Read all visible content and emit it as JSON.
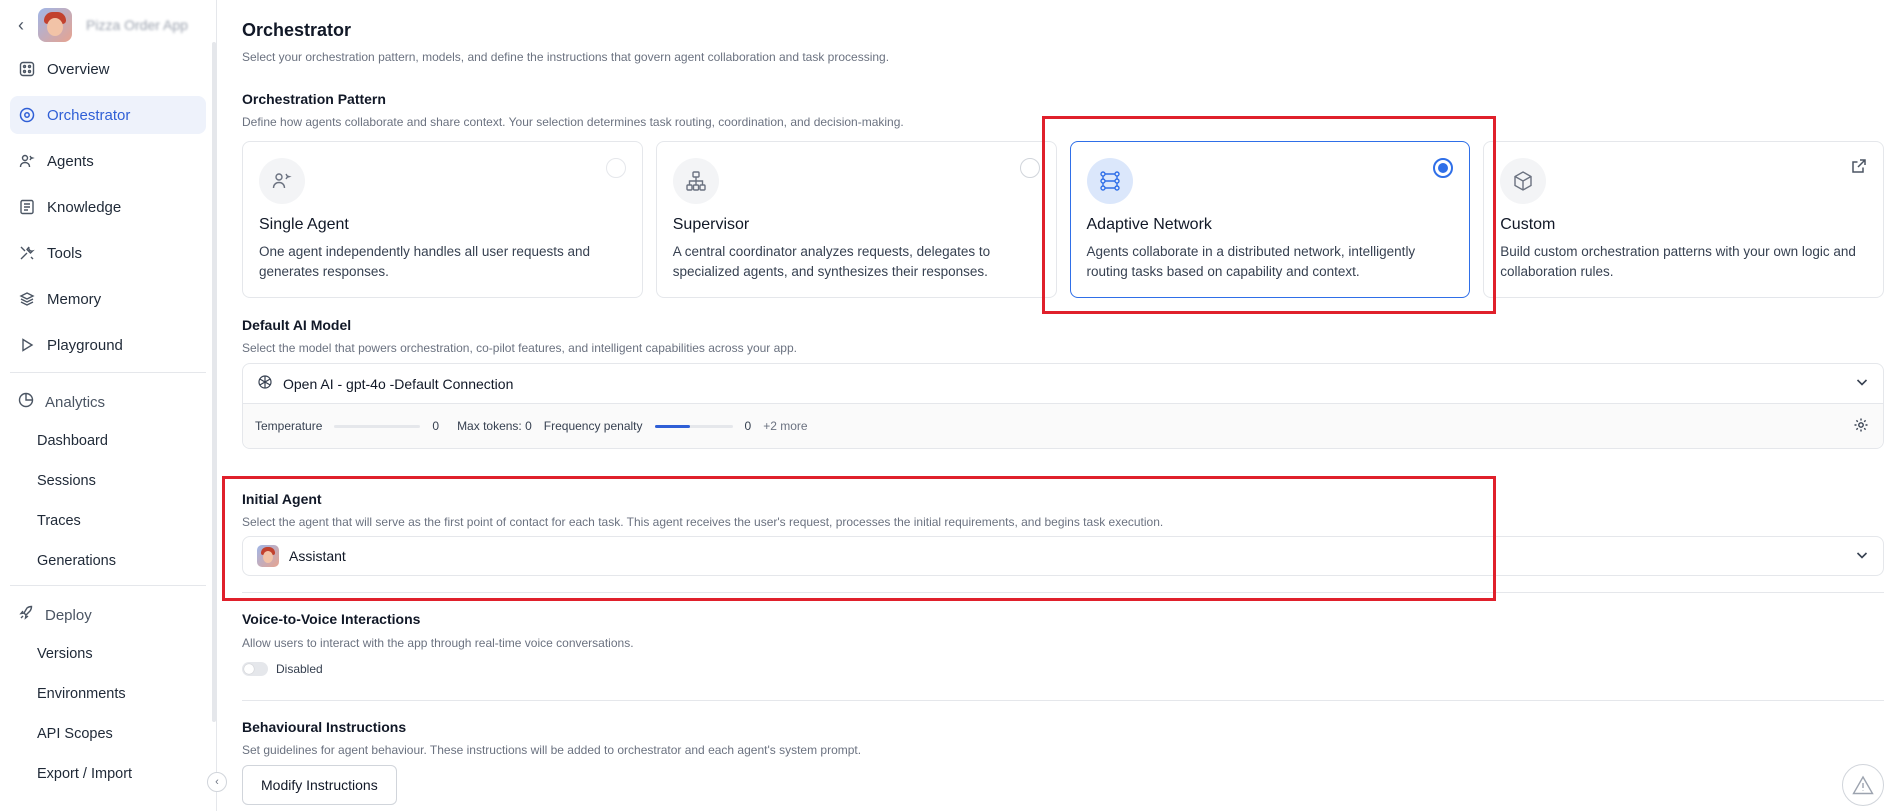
{
  "sidebar": {
    "app_name": "Pizza Order App",
    "items": [
      {
        "label": "Overview",
        "icon": "grid-icon"
      },
      {
        "label": "Orchestrator",
        "icon": "orchestrator-icon"
      },
      {
        "label": "Agents",
        "icon": "agents-icon"
      },
      {
        "label": "Knowledge",
        "icon": "book-icon"
      },
      {
        "label": "Tools",
        "icon": "tools-icon"
      },
      {
        "label": "Memory",
        "icon": "layers-icon"
      },
      {
        "label": "Playground",
        "icon": "play-icon"
      }
    ],
    "analytics": {
      "label": "Analytics",
      "items": [
        "Dashboard",
        "Sessions",
        "Traces",
        "Generations"
      ]
    },
    "deploy": {
      "label": "Deploy",
      "items": [
        "Versions",
        "Environments",
        "API Scopes",
        "Export / Import"
      ]
    }
  },
  "main": {
    "title": "Orchestrator",
    "subtitle": "Select your orchestration pattern, models, and define the instructions that govern agent collaboration and task processing.",
    "pattern": {
      "title": "Orchestration Pattern",
      "desc": "Define how agents collaborate and share context. Your selection determines task routing, coordination, and decision-making.",
      "cards": [
        {
          "title": "Single Agent",
          "desc": "One agent independently handles all user requests and generates responses."
        },
        {
          "title": "Supervisor",
          "desc": "A central coordinator analyzes requests, delegates to specialized agents, and synthesizes their responses."
        },
        {
          "title": "Adaptive Network",
          "desc": "Agents collaborate in a distributed network, intelligently routing tasks based on capability and context."
        },
        {
          "title": "Custom",
          "desc": "Build custom orchestration patterns with your own logic and collaboration rules."
        }
      ]
    },
    "model": {
      "title": "Default AI Model",
      "desc": "Select the model that powers orchestration, co-pilot features, and intelligent capabilities across your app.",
      "selected": "Open AI - gpt-4o -Default Connection",
      "temperature_label": "Temperature",
      "temperature_value": "0",
      "max_tokens": "Max tokens: 0",
      "freq_label": "Frequency penalty",
      "freq_value": "0",
      "more": "+2 more"
    },
    "initial_agent": {
      "title": "Initial Agent",
      "desc": "Select the agent that will serve as the first point of contact for each task. This agent receives the user's request, processes the initial requirements, and begins task execution.",
      "selected": "Assistant"
    },
    "voice": {
      "title": "Voice-to-Voice Interactions",
      "desc": "Allow users to interact with the app through real-time voice conversations.",
      "status": "Disabled"
    },
    "behaviour": {
      "title": "Behavioural Instructions",
      "desc": "Set guidelines for agent behaviour. These instructions will be added to orchestrator and each agent's system prompt.",
      "button": "Modify Instructions"
    }
  }
}
